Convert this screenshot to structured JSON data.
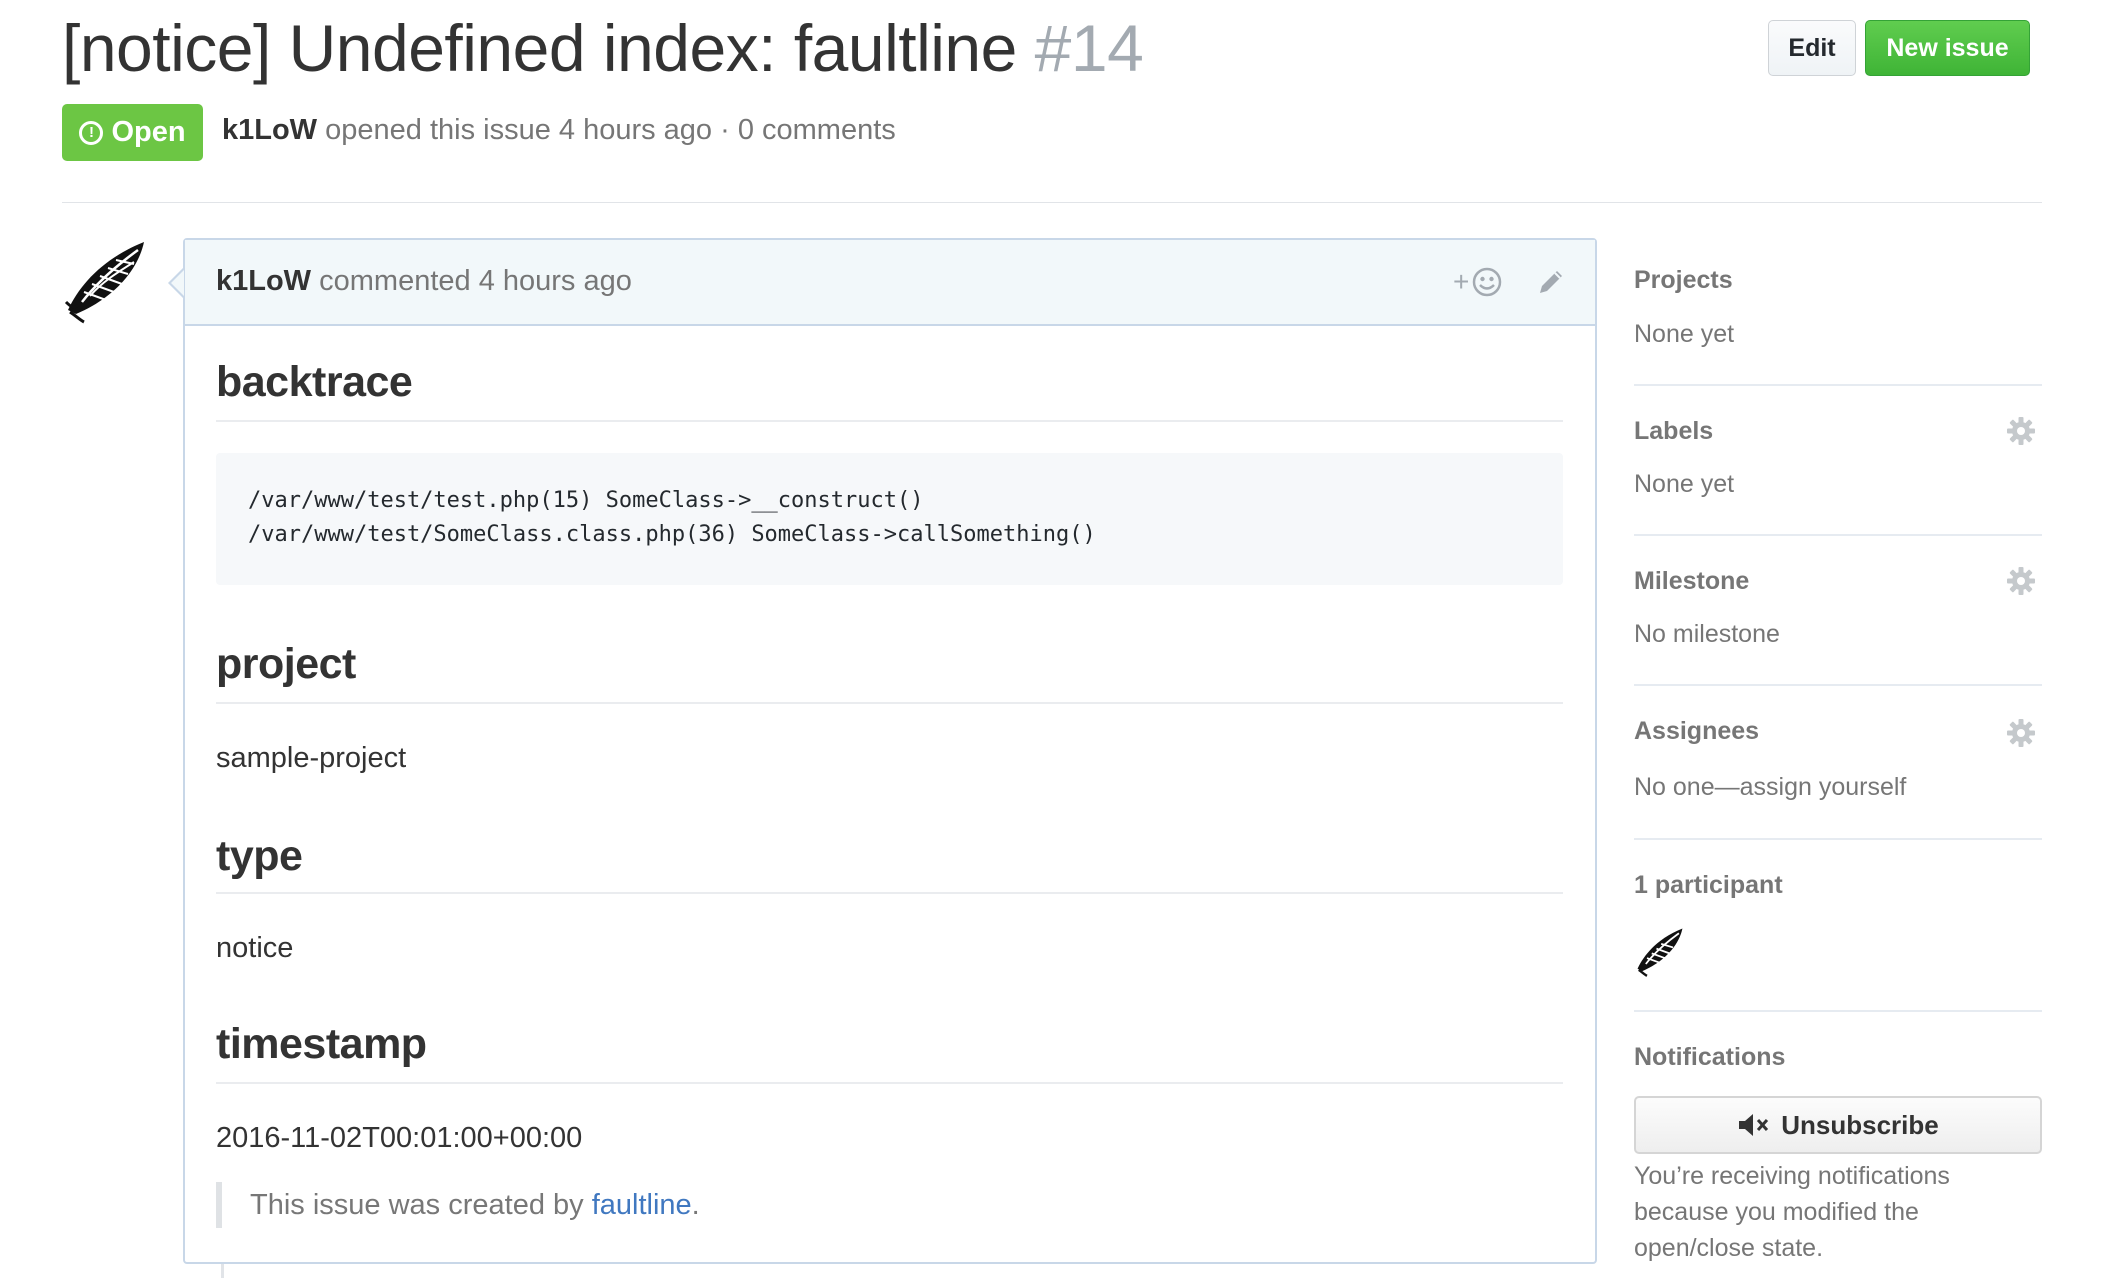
{
  "issue": {
    "title": "[notice] Undefined index: faultline",
    "number": "#14",
    "state": "Open",
    "author": "k1LoW",
    "meta_rest": "opened this issue 4 hours ago · 0 comments"
  },
  "header_buttons": {
    "edit_label": "Edit",
    "new_issue_label": "New issue"
  },
  "comment": {
    "author": "k1LoW",
    "time_text": "commented 4 hours ago",
    "sections": {
      "backtrace_heading": "backtrace",
      "backtrace_lines": "/var/www/test/test.php(15) SomeClass->__construct()\n/var/www/test/SomeClass.class.php(36) SomeClass->callSomething()",
      "project_heading": "project",
      "project_value": "sample-project",
      "type_heading": "type",
      "type_value": "notice",
      "timestamp_heading": "timestamp",
      "timestamp_value": "2016-11-02T00:01:00+00:00"
    },
    "footer_prefix": "This issue was created by ",
    "footer_link": "faultline",
    "footer_suffix": "."
  },
  "sidebar": {
    "projects": {
      "heading": "Projects",
      "value": "None yet"
    },
    "labels": {
      "heading": "Labels",
      "value": "None yet"
    },
    "milestone": {
      "heading": "Milestone",
      "value": "No milestone"
    },
    "assignees": {
      "heading": "Assignees",
      "value": "No one—assign yourself"
    },
    "participants": {
      "heading": "1 participant"
    },
    "notifications": {
      "heading": "Notifications",
      "button_label": "Unsubscribe",
      "reason": "You’re receiving notifications because you modified the open/close state."
    }
  },
  "colors": {
    "open_green": "#6cc644",
    "new_issue_green": "#3fb436",
    "link_blue": "#4078c0",
    "comment_header_bg": "#f2f8fa"
  },
  "icons": [
    "alert-icon",
    "smiley-icon",
    "pencil-icon",
    "gear-icon",
    "mute-icon"
  ]
}
